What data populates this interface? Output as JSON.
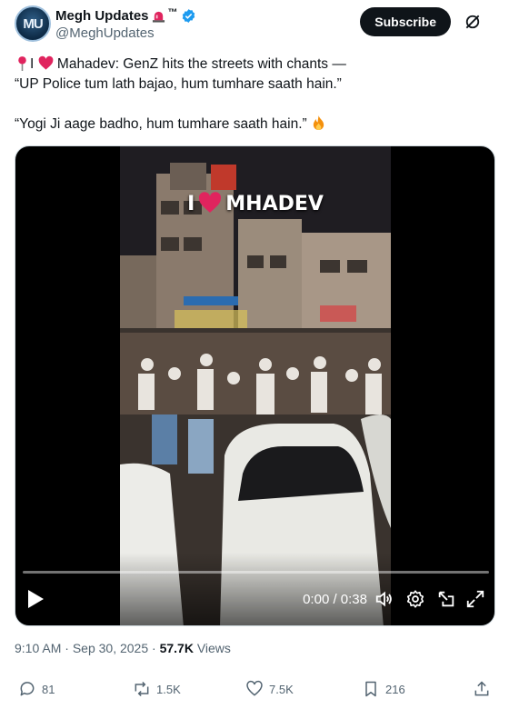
{
  "author": {
    "display_name": "Megh Updates",
    "tm": "™",
    "handle": "@MeghUpdates",
    "avatar_initials": "MU",
    "verified": true
  },
  "header": {
    "subscribe_label": "Subscribe"
  },
  "tweet": {
    "line1_prefix": "I",
    "line1_rest": " Mahadev: GenZ hits the streets with chants —",
    "line2": "“UP Police tum lath bajao, hum tumhare saath hain.”",
    "line3": "“Yogi Ji aage badho, hum tumhare saath hain.”"
  },
  "video": {
    "overlay_prefix": "I",
    "overlay_word": "MHADEV",
    "time_display": "0:00 / 0:38",
    "progress": 0.0
  },
  "meta": {
    "time": "9:10 AM",
    "separator": " · ",
    "date": "Sep 30, 2025",
    "views_count": "57.7K",
    "views_label": " Views"
  },
  "actions": {
    "replies": "81",
    "reposts": "1.5K",
    "likes": "7.5K",
    "bookmarks": "216"
  },
  "colors": {
    "accent": "#1d9bf0",
    "heart": "#e0245e",
    "text_secondary": "#536471"
  }
}
